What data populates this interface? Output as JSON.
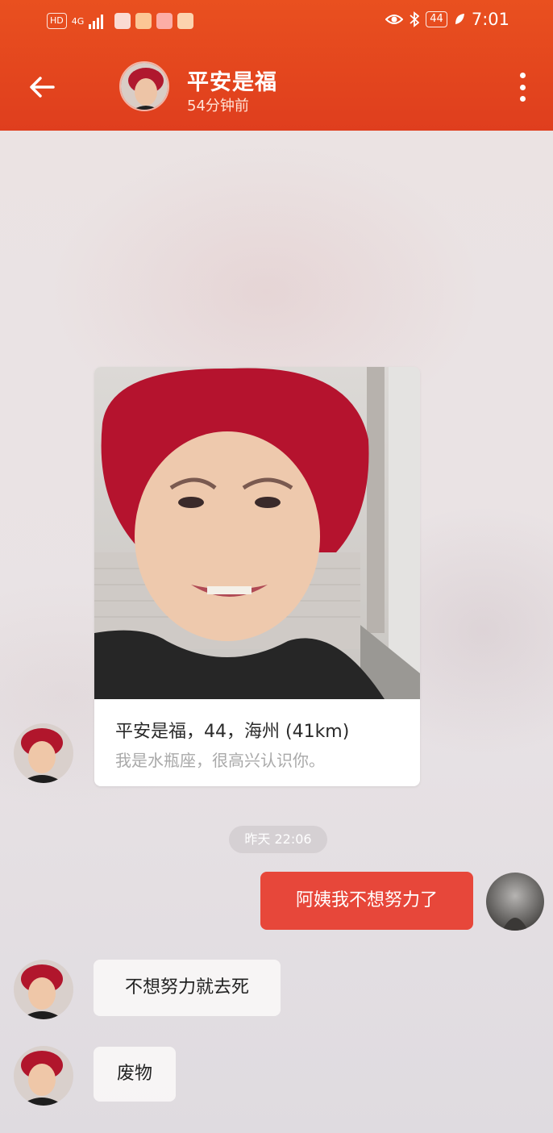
{
  "status_bar": {
    "left_badges": [
      "HD",
      "4G"
    ],
    "battery": "44",
    "time": "7:01"
  },
  "header": {
    "title": "平安是福",
    "subtitle": "54分钟前",
    "accent_color": "#e2431e"
  },
  "profile_card": {
    "line1": "平安是福，44，海州 (41km)",
    "line2": "我是水瓶座，很高兴认识你。"
  },
  "timestamp": "昨天 22:06",
  "messages": [
    {
      "from": "me",
      "text": "阿姨我不想努力了"
    },
    {
      "from": "contact",
      "text": "不想努力就去死"
    },
    {
      "from": "contact",
      "text": "废物"
    }
  ],
  "icons": [
    "back-arrow-icon",
    "more-vertical-icon",
    "eye-icon",
    "bluetooth-icon",
    "leaf-icon"
  ]
}
